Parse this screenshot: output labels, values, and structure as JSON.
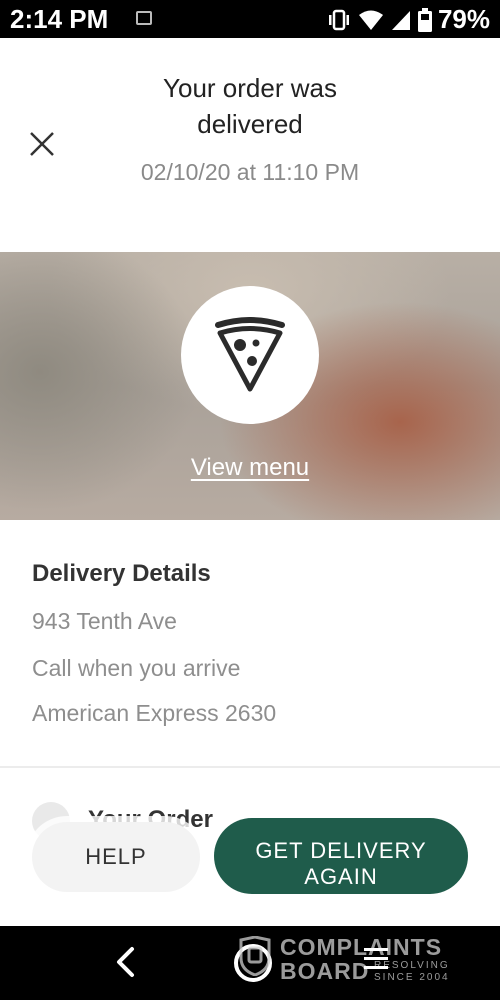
{
  "status_bar": {
    "time": "2:14 PM",
    "battery": "79%",
    "icons": [
      "gallery-icon",
      "vibrate-icon",
      "wifi-icon",
      "signal-icon",
      "battery-icon"
    ]
  },
  "header": {
    "close_icon": "close-icon",
    "title": "Your order was delivered",
    "date": "02/10/20 at 11:10 PM"
  },
  "hero": {
    "logo_icon": "pizza-slice-icon",
    "view_menu": "View menu"
  },
  "delivery_details": {
    "title": "Delivery Details",
    "address": "943 Tenth Ave",
    "note": "Call when you arrive",
    "payment": "American Express 2630"
  },
  "order": {
    "title": "Your Order"
  },
  "actions": {
    "help": "HELP",
    "get_delivery_again": "GET DELIVERY AGAIN"
  },
  "nav": {
    "icons": [
      "back-icon",
      "home-icon",
      "recents-icon"
    ]
  },
  "watermark": {
    "line1": "COMPLAINTS",
    "line2": "BOARD",
    "sub1": "RESOLVING",
    "sub2": "SINCE 2004"
  },
  "colors": {
    "accent": "#1f5c4b",
    "text_primary": "#333333",
    "text_secondary": "#8e8e8e"
  }
}
